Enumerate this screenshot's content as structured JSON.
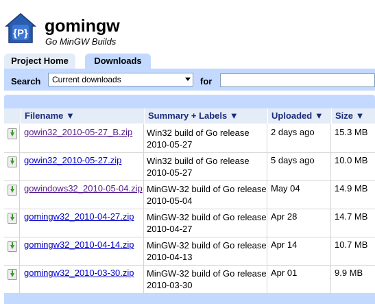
{
  "project": {
    "name": "gomingw",
    "summary": "Go MinGW Builds",
    "logo_icon": "project-logo-icon",
    "logo_letter": "{P}"
  },
  "tabs": [
    {
      "label": "Project Home"
    },
    {
      "label": "Downloads"
    }
  ],
  "search": {
    "label": "Search",
    "select_value": "Current downloads",
    "for_label": "for",
    "query": ""
  },
  "table": {
    "columns": [
      "Filename ▼",
      "Summary + Labels ▼",
      "Uploaded ▼",
      "Size ▼"
    ],
    "rows": [
      {
        "filename": "gowin32_2010-05-27_B.zip",
        "summary": "Win32 build of Go release 2010-05-27",
        "uploaded": "2 days ago",
        "size": "15.3 MB",
        "visited": true
      },
      {
        "filename": "gowin32_2010-05-27.zip",
        "summary": "Win32 build of Go release 2010-05-27",
        "uploaded": "5 days ago",
        "size": "10.0 MB",
        "visited": false
      },
      {
        "filename": "gowindows32_2010-05-04.zip",
        "summary": "MinGW-32 build of Go release 2010-05-04",
        "uploaded": "May 04",
        "size": "14.9 MB",
        "visited": true
      },
      {
        "filename": "gomingw32_2010-04-27.zip",
        "summary": "MinGW-32 build of Go release 2010-04-27",
        "uploaded": "Apr 28",
        "size": "14.7 MB",
        "visited": false
      },
      {
        "filename": "gomingw32_2010-04-14.zip",
        "summary": "MinGW-32 build of Go release 2010-04-13",
        "uploaded": "Apr 14",
        "size": "10.7 MB",
        "visited": false
      },
      {
        "filename": "gomingw32_2010-03-30.zip",
        "summary": "MinGW-32 build of Go release 2010-03-30",
        "uploaded": "Apr 01",
        "size": "9.9 MB",
        "visited": false
      }
    ]
  },
  "colors": {
    "accent": "#c3d9ff",
    "header_bg": "#e4ecf8",
    "link": "#0000cc",
    "visited_link": "#551a8b"
  }
}
